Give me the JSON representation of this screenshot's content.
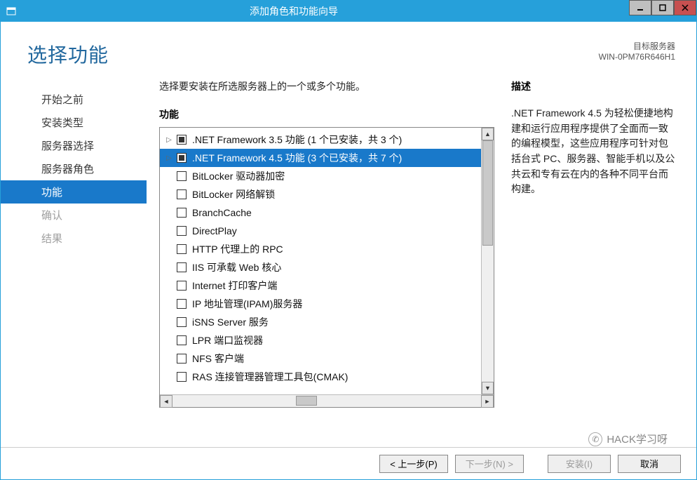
{
  "window": {
    "title": "添加角色和功能向导"
  },
  "header": {
    "page_title": "选择功能",
    "destination_label": "目标服务器",
    "destination_server": "WIN-0PM76R646H1"
  },
  "nav": {
    "items": [
      {
        "label": "开始之前",
        "state": "normal"
      },
      {
        "label": "安装类型",
        "state": "normal"
      },
      {
        "label": "服务器选择",
        "state": "normal"
      },
      {
        "label": "服务器角色",
        "state": "normal"
      },
      {
        "label": "功能",
        "state": "active"
      },
      {
        "label": "确认",
        "state": "disabled"
      },
      {
        "label": "结果",
        "state": "disabled"
      }
    ]
  },
  "main": {
    "instruction": "选择要安装在所选服务器上的一个或多个功能。",
    "list_heading": "功能",
    "features": [
      {
        "label": ".NET Framework 3.5 功能 (1 个已安装，共 3 个)",
        "expandable": true,
        "check": "indeterminate",
        "selected": false
      },
      {
        "label": ".NET Framework 4.5 功能 (3 个已安装，共 7 个)",
        "expandable": true,
        "check": "indeterminate",
        "selected": true
      },
      {
        "label": "BitLocker 驱动器加密",
        "expandable": false,
        "check": "unchecked",
        "selected": false
      },
      {
        "label": "BitLocker 网络解锁",
        "expandable": false,
        "check": "unchecked",
        "selected": false
      },
      {
        "label": "BranchCache",
        "expandable": false,
        "check": "unchecked",
        "selected": false
      },
      {
        "label": "DirectPlay",
        "expandable": false,
        "check": "unchecked",
        "selected": false
      },
      {
        "label": "HTTP 代理上的 RPC",
        "expandable": false,
        "check": "unchecked",
        "selected": false
      },
      {
        "label": "IIS 可承载 Web 核心",
        "expandable": false,
        "check": "unchecked",
        "selected": false
      },
      {
        "label": "Internet 打印客户端",
        "expandable": false,
        "check": "unchecked",
        "selected": false
      },
      {
        "label": "IP 地址管理(IPAM)服务器",
        "expandable": false,
        "check": "unchecked",
        "selected": false
      },
      {
        "label": "iSNS Server 服务",
        "expandable": false,
        "check": "unchecked",
        "selected": false
      },
      {
        "label": "LPR 端口监视器",
        "expandable": false,
        "check": "unchecked",
        "selected": false
      },
      {
        "label": "NFS 客户端",
        "expandable": false,
        "check": "unchecked",
        "selected": false
      },
      {
        "label": "RAS 连接管理器管理工具包(CMAK)",
        "expandable": false,
        "check": "unchecked",
        "selected": false
      }
    ]
  },
  "description": {
    "heading": "描述",
    "text": ".NET Framework 4.5 为轻松便捷地构建和运行应用程序提供了全面而一致的编程模型，这些应用程序可针对包括台式 PC、服务器、智能手机以及公共云和专有云在内的各种不同平台而构建。"
  },
  "buttons": {
    "prev": "< 上一步(P)",
    "next": "下一步(N) >",
    "install": "安装(I)",
    "cancel": "取消"
  },
  "watermark": "HACK学习呀"
}
